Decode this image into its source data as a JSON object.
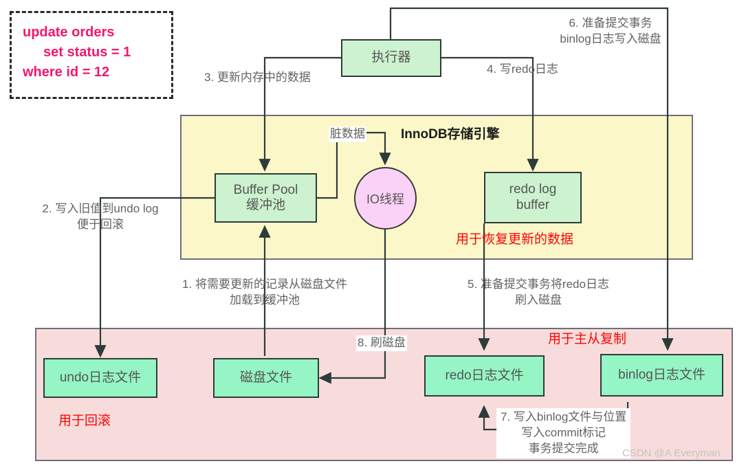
{
  "diagram": {
    "title_innodb": "InnoDB存储引擎",
    "watermark": "CSDN @A Everyman"
  },
  "sql": {
    "line1": "update orders",
    "line2": "set status = 1",
    "line3": "where id = 12"
  },
  "nodes": {
    "executor": "执行器",
    "buffer_pool_en": "Buffer Pool",
    "buffer_pool_cn": "缓冲池",
    "io_thread": "IO线程",
    "redo_log_buffer_l1": "redo log",
    "redo_log_buffer_l2": "buffer",
    "undo_file": "undo日志文件",
    "disk_file": "磁盘文件",
    "redo_file": "redo日志文件",
    "binlog_file": "binlog日志文件"
  },
  "labels": {
    "step1_l1": "1. 将需要更新的记录从磁盘文件",
    "step1_l2": "加载到缓冲池",
    "step2_l1": "2. 写入旧值到undo log",
    "step2_l2": "便于回滚",
    "step3": "3. 更新内存中的数据",
    "step4": "4. 写redo日志",
    "step5_l1": "5. 准备提交事务将redo日志",
    "step5_l2": "刷入磁盘",
    "step6_l1": "6. 准备提交事务",
    "step6_l2": "binlog日志写入磁盘",
    "step7_l1": "7. 写入binlog文件与位置",
    "step7_l2": "写入commit标记",
    "step7_l3": "事务提交完成",
    "step8": "8. 刷磁盘",
    "dirty_data": "脏数据"
  },
  "annotations": {
    "recover_data": "用于恢复更新的数据",
    "rollback": "用于回滚",
    "replication": "用于主从复制"
  },
  "colors": {
    "node_fill": "#ccf2cf",
    "node_fill_bright": "#95f5c4",
    "node_border": "#2e3b3b",
    "innodb_fill": "#fbf7c8",
    "disk_fill": "#f8dcdc",
    "circle_fill": "#fbd2f7",
    "sql_text": "#f4176c",
    "annotation_red": "#fb0505",
    "label_gray": "#636363"
  }
}
